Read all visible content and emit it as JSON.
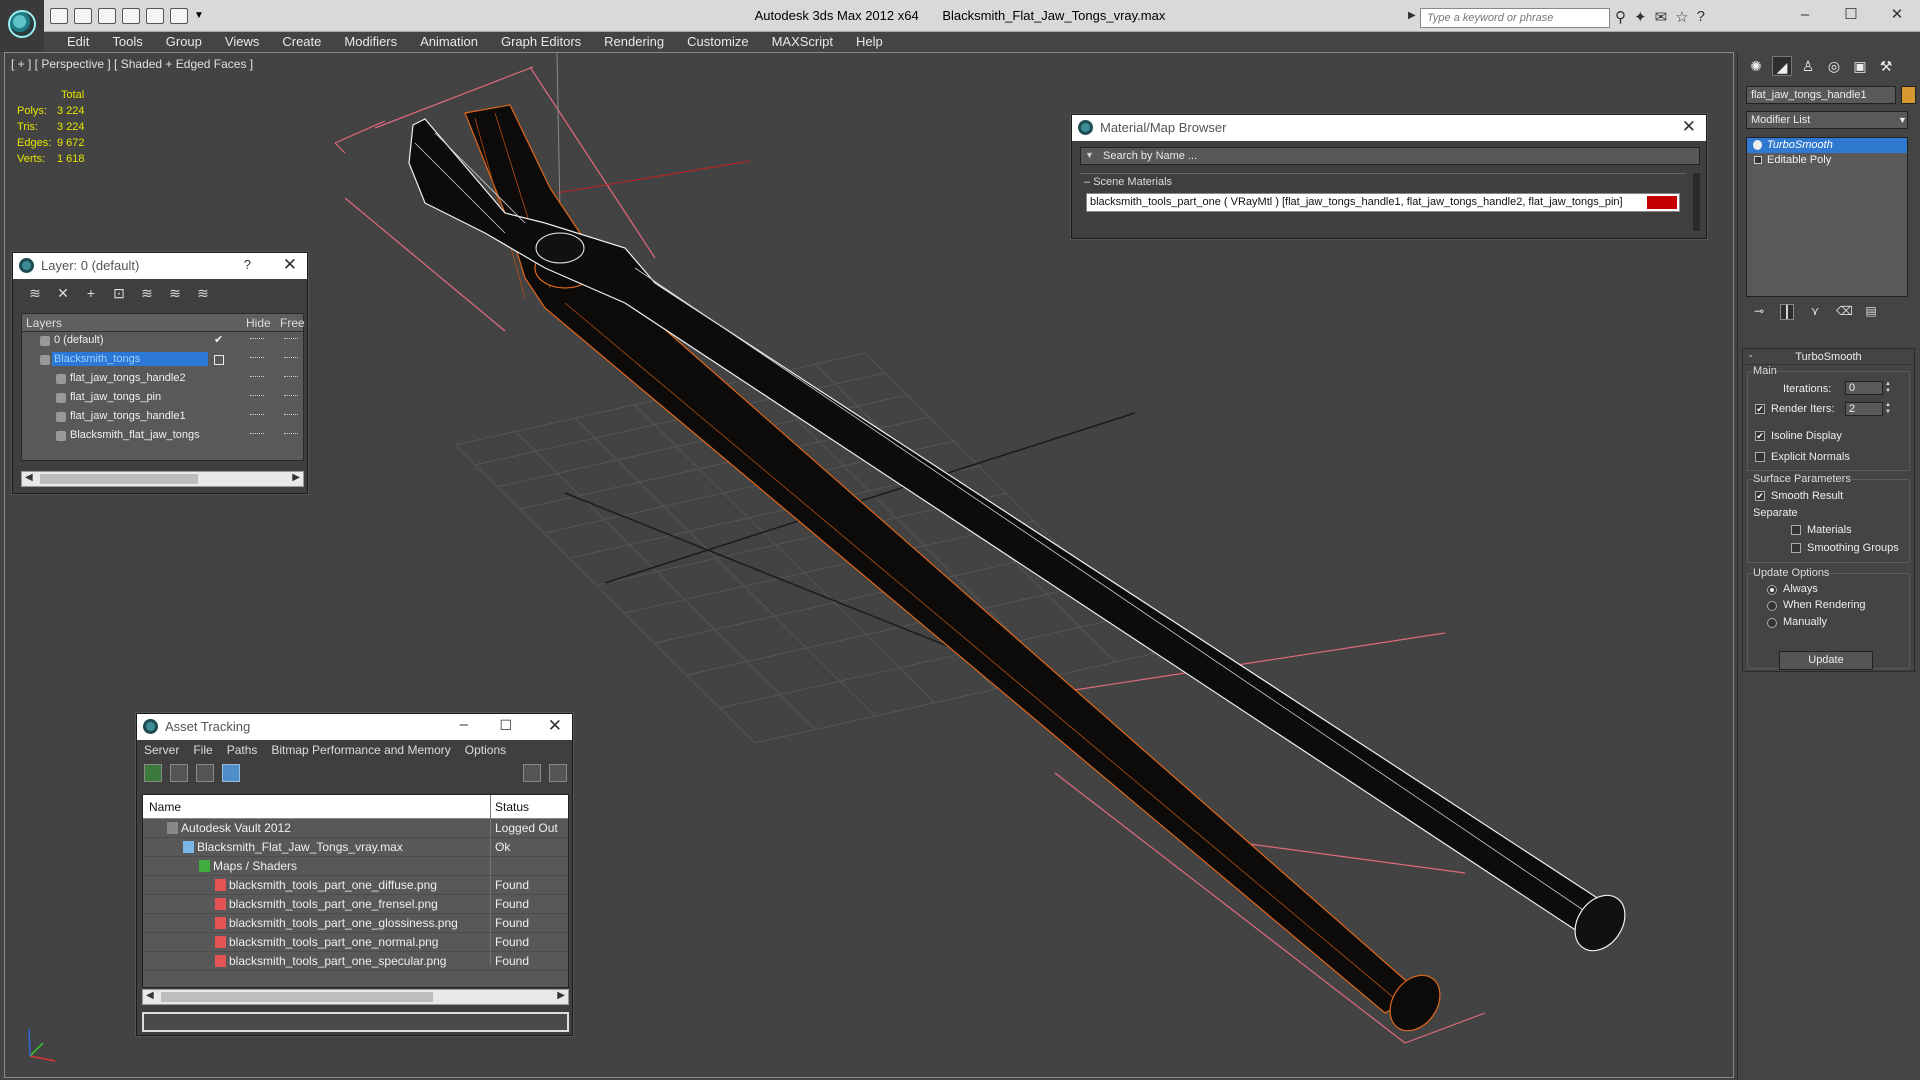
{
  "app": {
    "title": "Autodesk 3ds Max  2012 x64",
    "file": "Blacksmith_Flat_Jaw_Tongs_vray.max",
    "search_placeholder": "Type a keyword or phrase"
  },
  "menu": [
    "Edit",
    "Tools",
    "Group",
    "Views",
    "Create",
    "Modifiers",
    "Animation",
    "Graph Editors",
    "Rendering",
    "Customize",
    "MAXScript",
    "Help"
  ],
  "viewport": {
    "label": "[ + ] [ Perspective ] [ Shaded + Edged Faces ]",
    "stats": {
      "header": "Total",
      "rows": [
        {
          "label": "Polys:",
          "value": "3 224"
        },
        {
          "label": "Tris:",
          "value": "3 224"
        },
        {
          "label": "Edges:",
          "value": "9 672"
        },
        {
          "label": "Verts:",
          "value": "1 618"
        }
      ]
    }
  },
  "layer_window": {
    "title": "Layer: 0 (default)",
    "help": "?",
    "columns": {
      "layers": "Layers",
      "hide": "Hide",
      "freeze": "Free"
    },
    "rows": [
      {
        "name": "0 (default)",
        "indent": 0,
        "selected": false
      },
      {
        "name": "Blacksmith_tongs",
        "indent": 0,
        "selected": true
      },
      {
        "name": "flat_jaw_tongs_handle2",
        "indent": 1,
        "selected": false
      },
      {
        "name": "flat_jaw_tongs_pin",
        "indent": 1,
        "selected": false
      },
      {
        "name": "flat_jaw_tongs_handle1",
        "indent": 1,
        "selected": false
      },
      {
        "name": "Blacksmith_flat_jaw_tongs",
        "indent": 1,
        "selected": false
      }
    ]
  },
  "material_browser": {
    "title": "Material/Map Browser",
    "search": "Search by Name ...",
    "section": "Scene Materials",
    "item": "blacksmith_tools_part_one ( VRayMtl ) [flat_jaw_tongs_handle1, flat_jaw_tongs_handle2, flat_jaw_tongs_pin]",
    "swatch_color": "#c50000"
  },
  "asset_tracking": {
    "title": "Asset Tracking",
    "menu": [
      "Server",
      "File",
      "Paths",
      "Bitmap Performance and Memory",
      "Options"
    ],
    "columns": {
      "name": "Name",
      "status": "Status"
    },
    "rows": [
      {
        "name": "Autodesk Vault 2012",
        "status": "Logged Out ...",
        "icon": "vault-icon"
      },
      {
        "name": "Blacksmith_Flat_Jaw_Tongs_vray.max",
        "status": "Ok",
        "icon": "max-file-icon"
      },
      {
        "name": "Maps / Shaders",
        "status": "",
        "icon": "maps-icon"
      },
      {
        "name": "blacksmith_tools_part_one_diffuse.png",
        "status": "Found",
        "icon": "png-icon"
      },
      {
        "name": "blacksmith_tools_part_one_frensel.png",
        "status": "Found",
        "icon": "png-icon"
      },
      {
        "name": "blacksmith_tools_part_one_glossiness.png",
        "status": "Found",
        "icon": "png-icon"
      },
      {
        "name": "blacksmith_tools_part_one_normal.png",
        "status": "Found",
        "icon": "png-icon"
      },
      {
        "name": "blacksmith_tools_part_one_specular.png",
        "status": "Found",
        "icon": "png-icon"
      }
    ]
  },
  "command_panel": {
    "object_name": "flat_jaw_tongs_handle1",
    "object_color": "#d69930",
    "modifier_list": "Modifier List",
    "stack": [
      "TurboSmooth",
      "Editable Poly"
    ],
    "turbosmooth": {
      "title": "TurboSmooth",
      "main_label": "Main",
      "iterations_label": "Iterations:",
      "iterations": "0",
      "render_iters_label": "Render Iters:",
      "render_iters": "2",
      "render_iters_checked": true,
      "isoline_label": "Isoline Display",
      "isoline_checked": true,
      "explicit_label": "Explicit Normals",
      "explicit_checked": false,
      "surface_label": "Surface Parameters",
      "smooth_result_label": "Smooth Result",
      "smooth_result_checked": true,
      "separate_label": "Separate",
      "materials_label": "Materials",
      "smoothing_groups_label": "Smoothing Groups",
      "update_options_label": "Update Options",
      "always_label": "Always",
      "when_rendering_label": "When Rendering",
      "manually_label": "Manually",
      "update_option": "Always",
      "update_button": "Update"
    }
  }
}
